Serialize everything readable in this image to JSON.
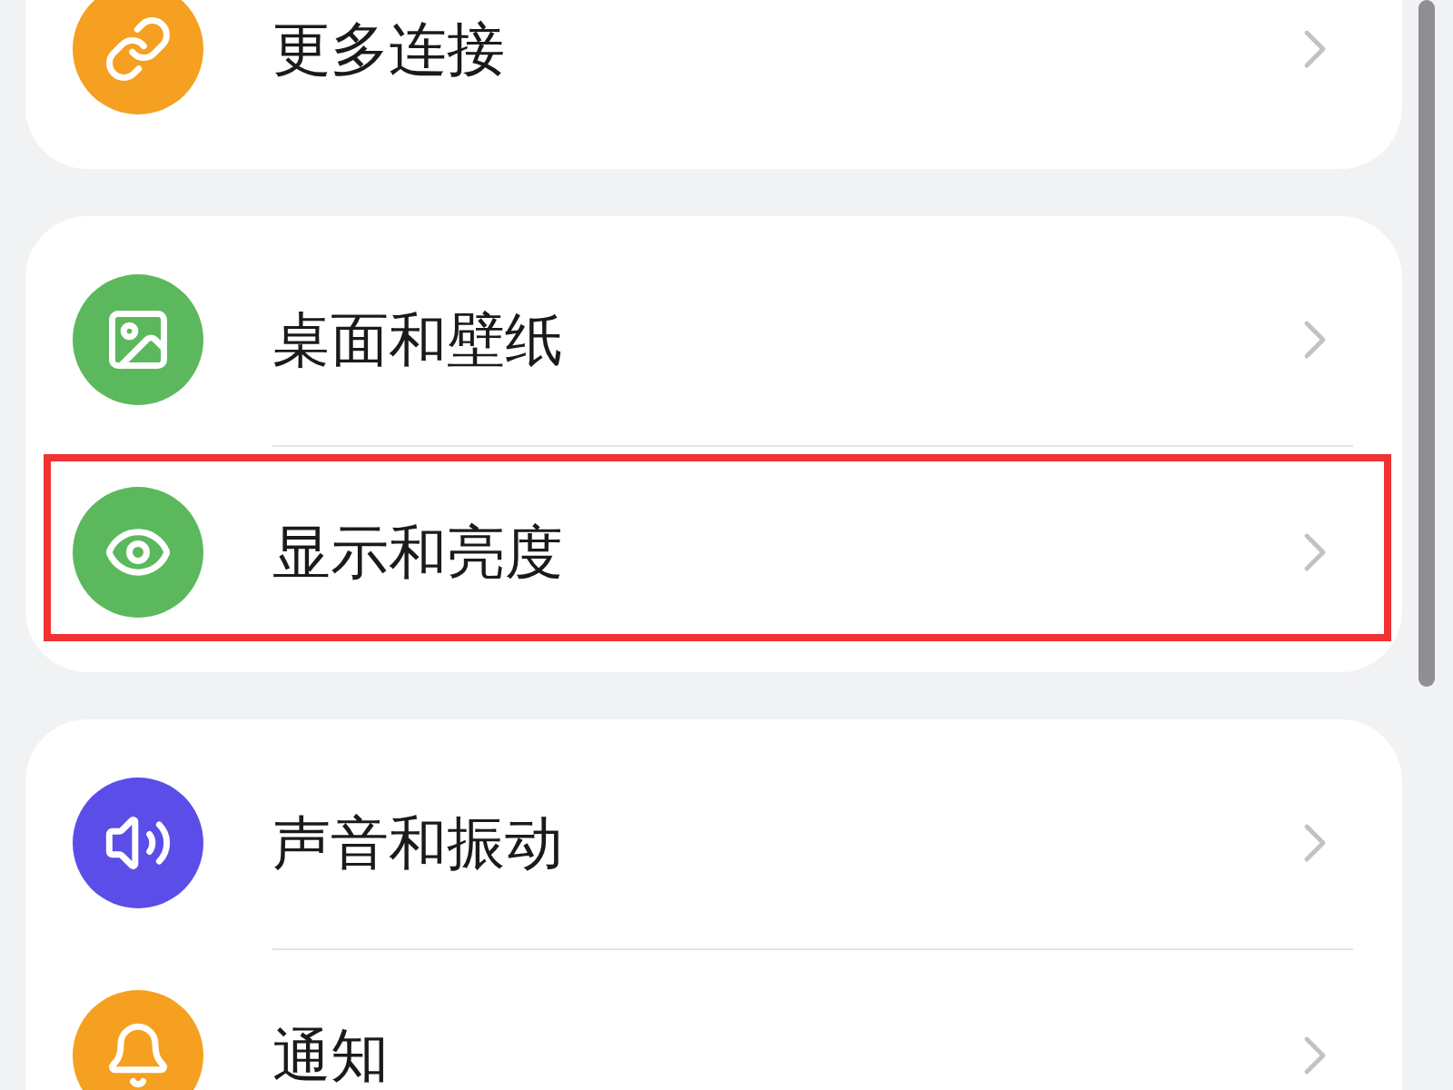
{
  "groups": [
    {
      "items": [
        {
          "label": "更多连接",
          "kind": "link",
          "color": "#f5a020",
          "highlighted": false
        }
      ]
    },
    {
      "items": [
        {
          "label": "桌面和壁纸",
          "kind": "image",
          "color": "#5cb85c",
          "highlighted": false
        },
        {
          "label": "显示和亮度",
          "kind": "eye",
          "color": "#5cb85c",
          "highlighted": true
        }
      ]
    },
    {
      "items": [
        {
          "label": "声音和振动",
          "kind": "sound",
          "color": "#5b4de8",
          "highlighted": false
        },
        {
          "label": "通知",
          "kind": "bell",
          "color": "#f5a020",
          "highlighted": false
        }
      ]
    }
  ]
}
